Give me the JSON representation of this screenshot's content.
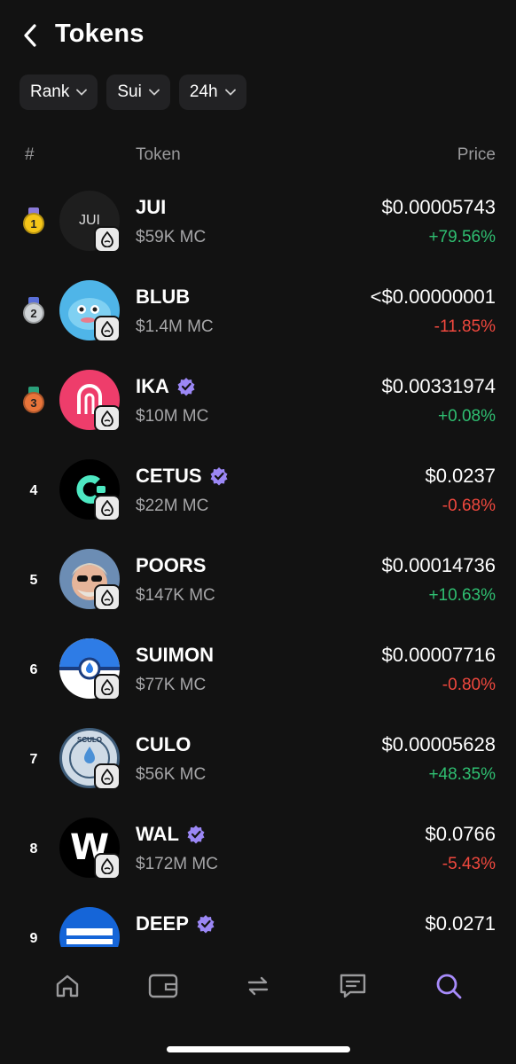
{
  "header": {
    "title": "Tokens"
  },
  "filters": [
    {
      "label": "Rank"
    },
    {
      "label": "Sui"
    },
    {
      "label": "24h"
    }
  ],
  "columns": {
    "rank": "#",
    "token": "Token",
    "price": "Price"
  },
  "tokens": [
    {
      "rank": "1",
      "medal": "gold",
      "name": "JUI",
      "verified": false,
      "mc": "$59K MC",
      "price": "$0.00005743",
      "change": "+79.56%",
      "dir": "up",
      "avatar_text": "JUI"
    },
    {
      "rank": "2",
      "medal": "silver",
      "name": "BLUB",
      "verified": false,
      "mc": "$1.4M MC",
      "price": "<$0.00000001",
      "change": "-11.85%",
      "dir": "down",
      "avatar_text": ""
    },
    {
      "rank": "3",
      "medal": "bronze",
      "name": "IKA",
      "verified": true,
      "mc": "$10M MC",
      "price": "$0.00331974",
      "change": "+0.08%",
      "dir": "up",
      "avatar_text": ""
    },
    {
      "rank": "4",
      "medal": "",
      "name": "CETUS",
      "verified": true,
      "mc": "$22M MC",
      "price": "$0.0237",
      "change": "-0.68%",
      "dir": "down",
      "avatar_text": ""
    },
    {
      "rank": "5",
      "medal": "",
      "name": "POORS",
      "verified": false,
      "mc": "$147K MC",
      "price": "$0.00014736",
      "change": "+10.63%",
      "dir": "up",
      "avatar_text": ""
    },
    {
      "rank": "6",
      "medal": "",
      "name": "SUIMON",
      "verified": false,
      "mc": "$77K MC",
      "price": "$0.00007716",
      "change": "-0.80%",
      "dir": "down",
      "avatar_text": ""
    },
    {
      "rank": "7",
      "medal": "",
      "name": "CULO",
      "verified": false,
      "mc": "$56K MC",
      "price": "$0.00005628",
      "change": "+48.35%",
      "dir": "up",
      "avatar_text": "SCULO"
    },
    {
      "rank": "8",
      "medal": "",
      "name": "WAL",
      "verified": true,
      "mc": "$172M MC",
      "price": "$0.0766",
      "change": "-5.43%",
      "dir": "down",
      "avatar_text": "W"
    },
    {
      "rank": "9",
      "medal": "",
      "name": "DEEP",
      "verified": true,
      "mc": "",
      "price": "$0.0271",
      "change": "",
      "dir": "up",
      "avatar_text": ""
    }
  ],
  "nav": [
    {
      "icon": "home-icon",
      "active": false
    },
    {
      "icon": "wallet-icon",
      "active": false
    },
    {
      "icon": "swap-icon",
      "active": false
    },
    {
      "icon": "chat-icon",
      "active": false
    },
    {
      "icon": "search-icon",
      "active": true
    }
  ],
  "colors": {
    "background": "#121212",
    "positive": "#2fbf71",
    "negative": "#f0483e",
    "accent": "#a78bfa",
    "muted": "#a6a6a8"
  }
}
